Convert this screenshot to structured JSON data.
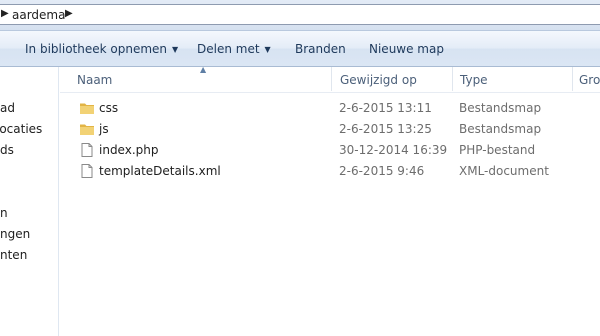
{
  "address": {
    "separator": "▶",
    "path_segment": "aardema"
  },
  "toolbar": {
    "include_library_label": "In bibliotheek opnemen",
    "share_label": "Delen met",
    "burn_label": "Branden",
    "new_folder_label": "Nieuwe map",
    "dropdown_arrow": "▼"
  },
  "nav_pane": {
    "items": [
      "ad",
      "locaties",
      "ds",
      "n",
      "ngen",
      "nten"
    ]
  },
  "columns": {
    "name": "Naam",
    "modified": "Gewijzigd op",
    "type": "Type",
    "size": "Gro",
    "sort_indicator": "▲"
  },
  "files": [
    {
      "name": "css",
      "modified": "2-6-2015 13:11",
      "type": "Bestandsmap",
      "icon": "folder-icon"
    },
    {
      "name": "js",
      "modified": "2-6-2015 13:25",
      "type": "Bestandsmap",
      "icon": "folder-icon"
    },
    {
      "name": "index.php",
      "modified": "30-12-2014 16:39",
      "type": "PHP-bestand",
      "icon": "file-icon"
    },
    {
      "name": "templateDetails.xml",
      "modified": "2-6-2015 9:46",
      "type": "XML-document",
      "icon": "file-icon"
    }
  ],
  "colors": {
    "toolbar_text": "#1e395b",
    "folder": "#e8c15a",
    "header_text": "#4c607a"
  }
}
